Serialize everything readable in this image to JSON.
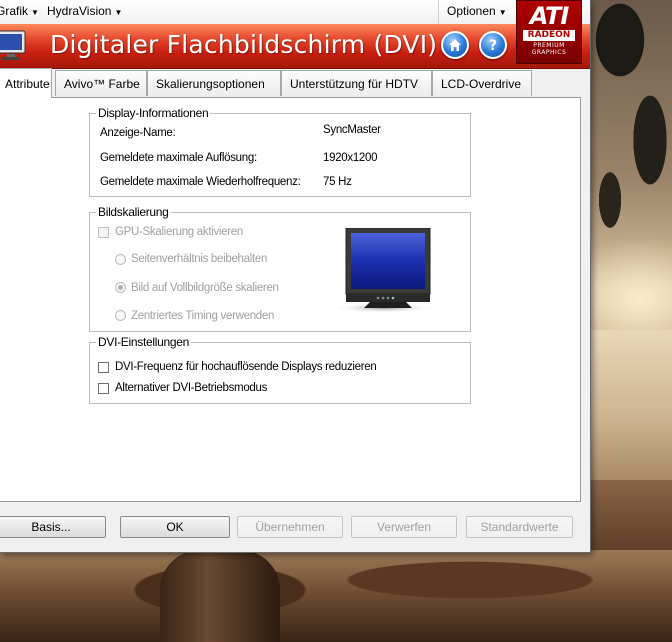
{
  "menubar": {
    "items": [
      "Grafik",
      "HydraVision"
    ],
    "options_label": "Optionen"
  },
  "banner": {
    "title": "Digitaler Flachbildschirm (DVI) 4",
    "home_icon": "home-icon",
    "help_icon": "help-icon",
    "logo": {
      "brand": "ATI",
      "product": "RADEON",
      "tagline_line1": "PREMIUM",
      "tagline_line2": "GRAPHICS"
    }
  },
  "tabs": [
    {
      "label": "Attribute",
      "active": true
    },
    {
      "label": "Avivo™ Farbe",
      "active": false
    },
    {
      "label": "Skalierungsoptionen",
      "active": false
    },
    {
      "label": "Unterstützung für HDTV",
      "active": false
    },
    {
      "label": "LCD-Overdrive",
      "active": false
    }
  ],
  "display_info": {
    "title": "Display-Informationen",
    "rows": [
      {
        "label": "Anzeige-Name:",
        "value": "SyncMaster"
      },
      {
        "label": "Gemeldete maximale Auflösung:",
        "value": "1920x1200"
      },
      {
        "label": "Gemeldete maximale Wiederholfrequenz:",
        "value": "75 Hz"
      }
    ]
  },
  "scaling": {
    "title": "Bildskalierung",
    "gpu_scaling_label": "GPU-Skalierung aktivieren",
    "gpu_scaling_checked": false,
    "options": [
      {
        "label": "Seitenverhältnis beibehalten",
        "selected": false
      },
      {
        "label": "Bild auf Vollbildgröße skalieren",
        "selected": true
      },
      {
        "label": "Zentriertes Timing verwenden",
        "selected": false
      }
    ]
  },
  "dvi": {
    "title": "DVI-Einstellungen",
    "options": [
      {
        "label": "DVI-Frequenz für hochauflösende Displays reduzieren",
        "checked": false
      },
      {
        "label": "Alternativer DVI-Betriebsmodus",
        "checked": false
      }
    ]
  },
  "buttons": {
    "basis": "Basis...",
    "ok": "OK",
    "apply": "Übernehmen",
    "discard": "Verwerfen",
    "defaults": "Standardwerte"
  }
}
